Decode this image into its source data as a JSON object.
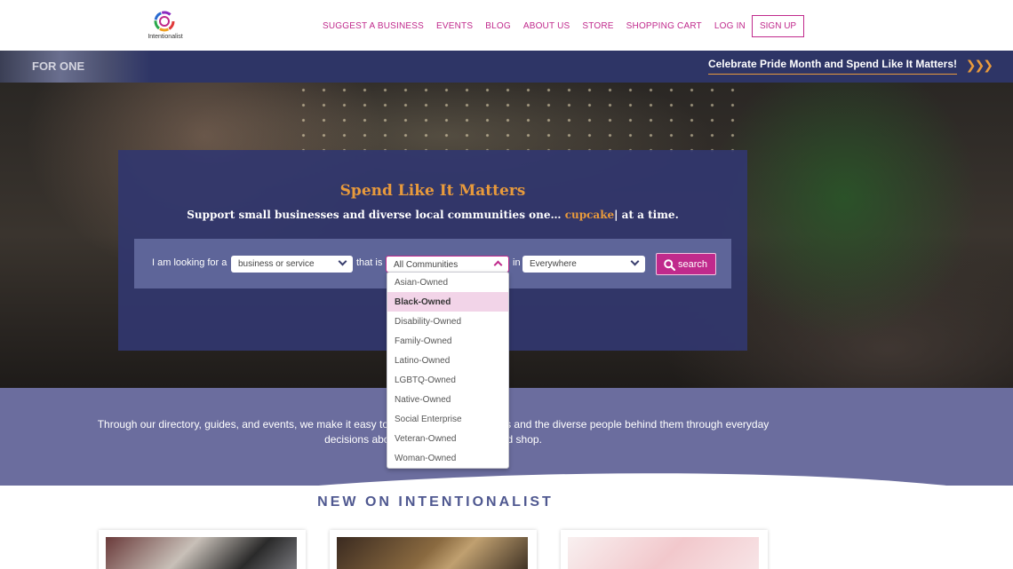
{
  "brand": {
    "logo_text": "Intentionalist",
    "accent_color": "#c02a8c",
    "orange_color": "#e89a3c",
    "navy_color": "#2e3566"
  },
  "nav": {
    "items": [
      {
        "label": "SUGGEST A BUSINESS"
      },
      {
        "label": "EVENTS"
      },
      {
        "label": "BLOG"
      },
      {
        "label": "ABOUT US"
      },
      {
        "label": "STORE"
      },
      {
        "label": "SHOPPING CART"
      },
      {
        "label": "LOG IN"
      }
    ],
    "signup_label": "SIGN UP"
  },
  "promo": {
    "photo_text": "FOR ONE",
    "text": "Celebrate Pride Month and Spend Like It Matters!",
    "arrows": "❯❯❯"
  },
  "hero": {
    "title": "Spend Like It Matters",
    "subtitle_prefix": "Support small businesses and diverse local communities one…",
    "subtitle_highlight": "cupcake",
    "subtitle_suffix": "| at a time."
  },
  "search": {
    "label_looking": "I am looking for a",
    "category_value": "business or service",
    "label_that_is": "that is",
    "community_value": "All Communities",
    "label_in": "in",
    "location_value": "Everywhere",
    "button_label": "search"
  },
  "community_options": {
    "selected_index": 1,
    "items": [
      "Asian-Owned",
      "Black-Owned",
      "Disability-Owned",
      "Family-Owned",
      "Latino-Owned",
      "LGBTQ-Owned",
      "Native-Owned",
      "Social Enterprise",
      "Veteran-Owned",
      "Woman-Owned"
    ]
  },
  "mission": {
    "text": "Through our directory, guides, and events, we make it easy to support small businesses and the diverse people behind them through everyday decisions about where to eat, drink, and shop."
  },
  "new_section": {
    "heading": "NEW ON INTENTIONALIST"
  }
}
